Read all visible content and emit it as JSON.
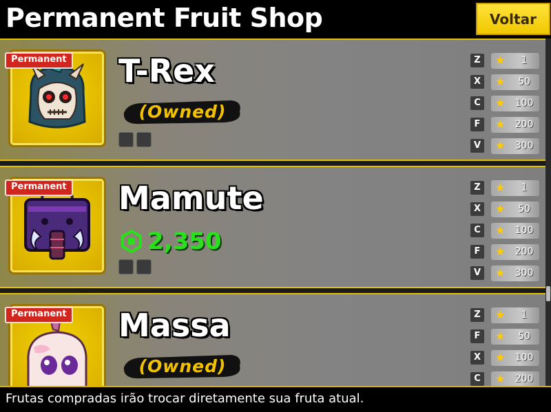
{
  "header": {
    "title": "Permanent Fruit Shop",
    "back_label": "Voltar"
  },
  "footer": {
    "text": "Frutas compradas irão trocar diretamente sua fruta atual."
  },
  "cards": [
    {
      "badge": "Permanent",
      "name": "T-Rex",
      "status": "(Owned)",
      "price": null,
      "moves": [
        {
          "key": "Z",
          "level": "1"
        },
        {
          "key": "X",
          "level": "50"
        },
        {
          "key": "C",
          "level": "100"
        },
        {
          "key": "F",
          "level": "200"
        },
        {
          "key": "V",
          "level": "300"
        }
      ]
    },
    {
      "badge": "Permanent",
      "name": "Mamute",
      "status": null,
      "price": "2,350",
      "moves": [
        {
          "key": "Z",
          "level": "1"
        },
        {
          "key": "X",
          "level": "50"
        },
        {
          "key": "C",
          "level": "100"
        },
        {
          "key": "F",
          "level": "200"
        },
        {
          "key": "V",
          "level": "300"
        }
      ]
    },
    {
      "badge": "Permanent",
      "name": "Massa",
      "status": "(Owned)",
      "price": null,
      "moves": [
        {
          "key": "Z",
          "level": "1"
        },
        {
          "key": "F",
          "level": "50"
        },
        {
          "key": "X",
          "level": "100"
        },
        {
          "key": "C",
          "level": "200"
        }
      ]
    }
  ]
}
